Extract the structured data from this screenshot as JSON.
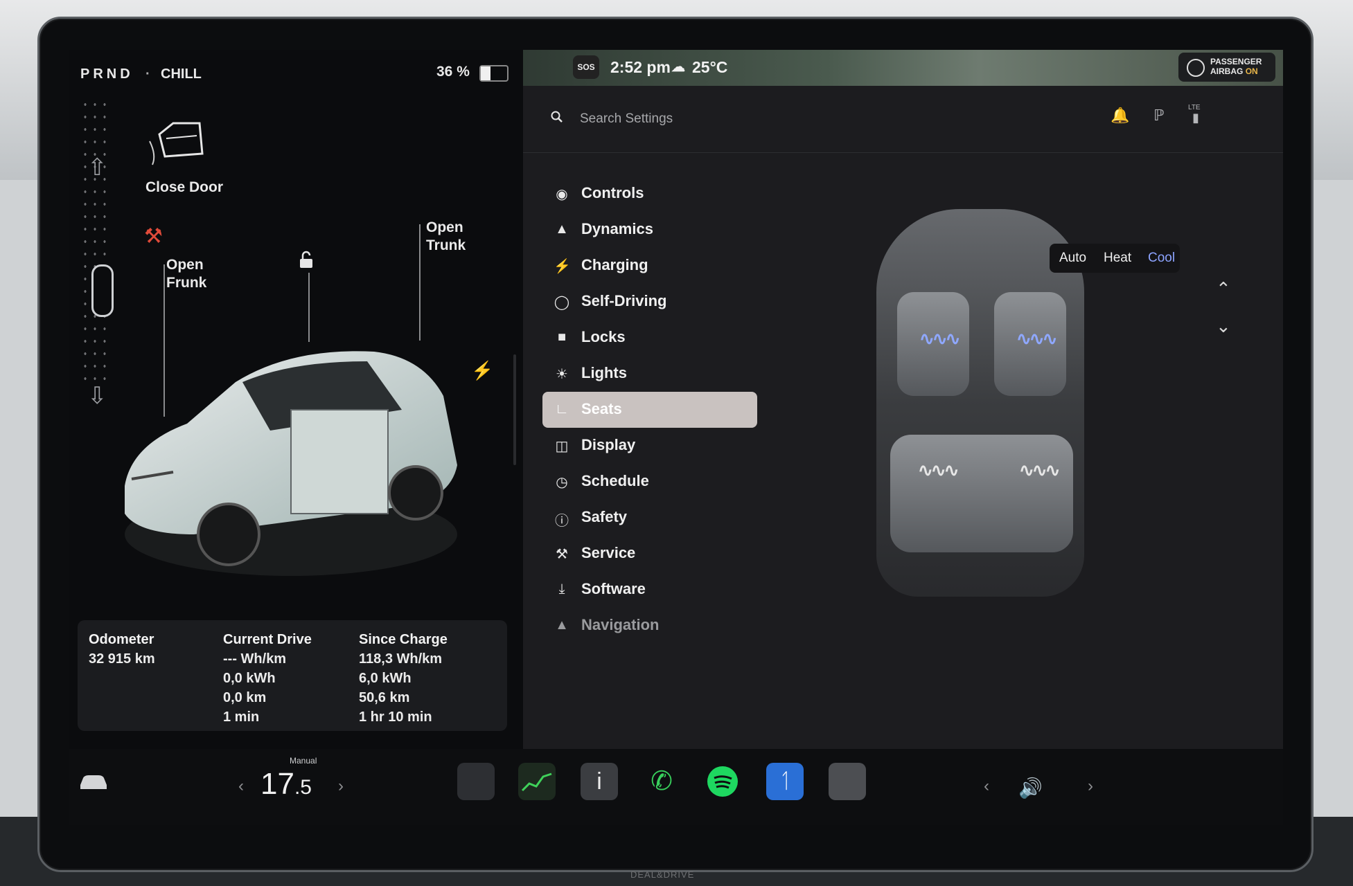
{
  "drive": {
    "gears": "PRND",
    "mode": "CHILL",
    "battery_percent": "36 %",
    "battery_level": 0.36
  },
  "vehicle": {
    "close_door_label": "Close Door",
    "open_frunk_label_line1": "Open",
    "open_frunk_label_line2": "Frunk",
    "open_trunk_label_line1": "Open",
    "open_trunk_label_line2": "Trunk"
  },
  "stats": {
    "odometer_label": "Odometer",
    "odometer_value": "32 915 km",
    "current_drive_label": "Current Drive",
    "current_drive": [
      "--- Wh/km",
      "0,0 kWh",
      "0,0 km",
      "1 min"
    ],
    "since_charge_label": "Since Charge",
    "since_charge": [
      "118,3 Wh/km",
      "6,0 kWh",
      "50,6 km",
      "1 hr 10 min"
    ]
  },
  "status": {
    "sos": "SOS",
    "time": "2:52 pm",
    "temperature": "25°C",
    "airbag_line1": "PASSENGER",
    "airbag_line2a": "AIRBAG",
    "airbag_line2b": "ON",
    "lte": "LTE"
  },
  "search": {
    "placeholder": "Search Settings"
  },
  "menu": [
    {
      "label": "Controls",
      "icon": "toggle-icon"
    },
    {
      "label": "Dynamics",
      "icon": "car-icon"
    },
    {
      "label": "Charging",
      "icon": "bolt-icon"
    },
    {
      "label": "Self-Driving",
      "icon": "steering-wheel-icon"
    },
    {
      "label": "Locks",
      "icon": "lock-icon"
    },
    {
      "label": "Lights",
      "icon": "sun-icon"
    },
    {
      "label": "Seats",
      "icon": "seat-icon"
    },
    {
      "label": "Display",
      "icon": "display-icon"
    },
    {
      "label": "Schedule",
      "icon": "alarm-clock-icon"
    },
    {
      "label": "Safety",
      "icon": "alert-circle-icon"
    },
    {
      "label": "Service",
      "icon": "wrench-icon"
    },
    {
      "label": "Software",
      "icon": "download-icon"
    },
    {
      "label": "Navigation",
      "icon": "navigation-arrow-icon"
    }
  ],
  "selected_menu": "Seats",
  "seat_mode": {
    "options": [
      "Auto",
      "Heat",
      "Cool"
    ],
    "selected": "Cool"
  },
  "climate": {
    "label": "Manual",
    "temp_whole": "17",
    "temp_decimal": ".5"
  },
  "colors": {
    "accent": "#8da4ff",
    "active_menu": "#c9c2c0",
    "warning": "#e04b3a"
  },
  "watermark": "DEAL&DRIVE"
}
